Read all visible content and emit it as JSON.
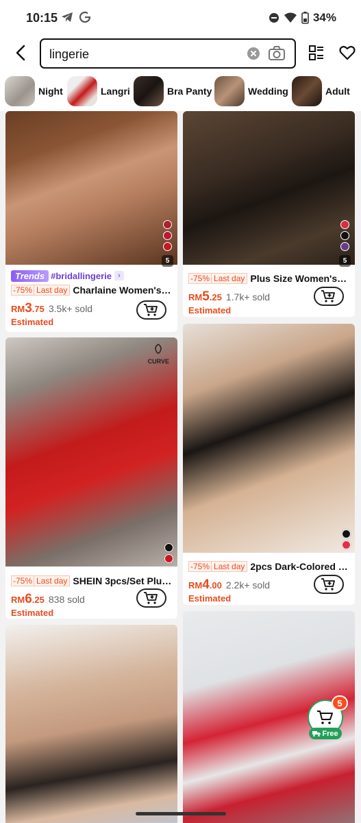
{
  "status_bar": {
    "time": "10:15",
    "battery": "34%"
  },
  "search": {
    "query": "lingerie"
  },
  "categories": [
    {
      "label": "Night"
    },
    {
      "label": "Langri"
    },
    {
      "label": "Bra Panty"
    },
    {
      "label": "Wedding"
    },
    {
      "label": "Adult"
    }
  ],
  "products": [
    {
      "trend_tag": "Trends",
      "hashtag": "#bridallingerie",
      "discount": "-75%",
      "badge": "Last day",
      "title": "Charlaine Women's S...",
      "currency": "RM",
      "price_int": "3",
      "price_dec": ".75",
      "sold": "3.5k+ sold",
      "estimated": "Estimated",
      "swatch_count": "5",
      "swatches": [
        "#b0202a",
        "#c01830",
        "#c81820"
      ]
    },
    {
      "discount": "-75%",
      "badge": "Last day",
      "title": "Plus Size Women's S...",
      "currency": "RM",
      "price_int": "5",
      "price_dec": ".25",
      "sold": "1.7k+ sold",
      "estimated": "Estimated",
      "swatch_count": "5",
      "swatches": [
        "#d33040",
        "#111111",
        "#6a3a8a"
      ]
    },
    {
      "brand_tag": "CURVE",
      "discount": "-75%",
      "badge": "Last day",
      "title": "SHEIN 3pcs/Set Plus...",
      "currency": "RM",
      "price_int": "6",
      "price_dec": ".25",
      "sold": "838 sold",
      "estimated": "Estimated",
      "swatches": [
        "#111111",
        "#c81820"
      ]
    },
    {
      "discount": "-75%",
      "badge": "Last day",
      "title": "2pcs Dark-Colored S...",
      "currency": "RM",
      "price_int": "4",
      "price_dec": ".00",
      "sold": "2.2k+ sold",
      "estimated": "Estimated",
      "swatches": [
        "#111111",
        "#e0304a"
      ]
    }
  ],
  "float_cart": {
    "count": "5",
    "free_label": "Free"
  },
  "colors": {
    "accent": "#e84b1c",
    "trend": "#6b3fd4",
    "free_green": "#22a05a"
  }
}
